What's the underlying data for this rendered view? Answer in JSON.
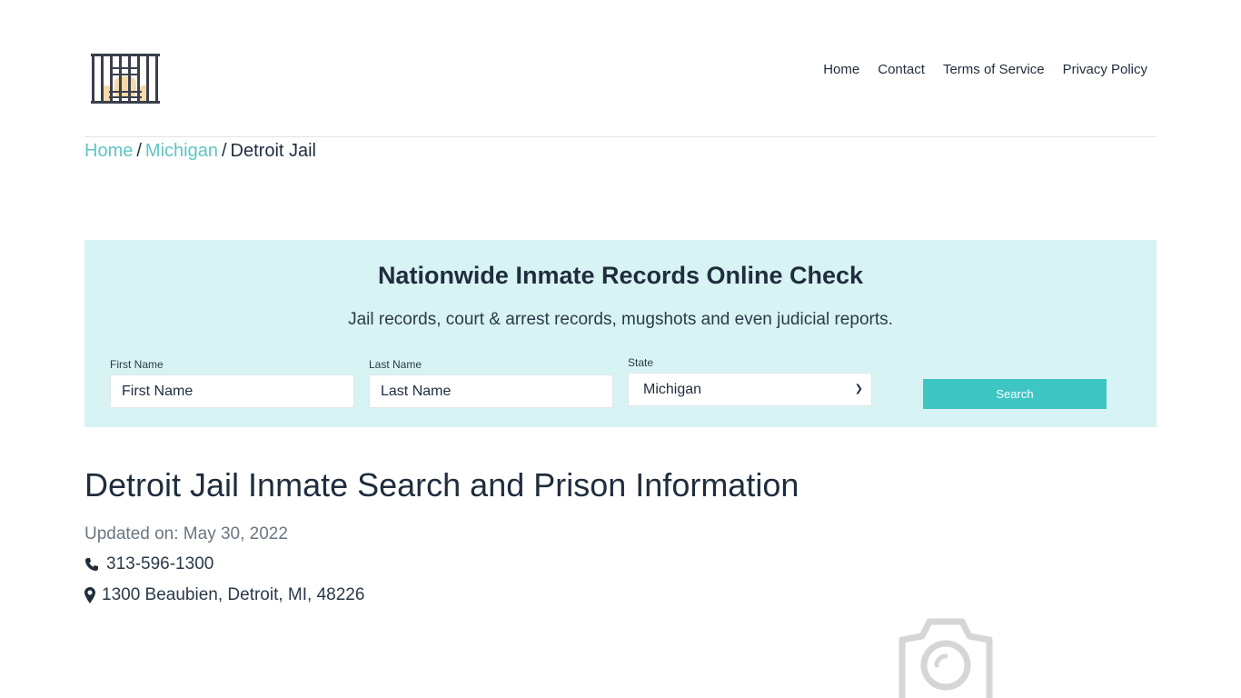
{
  "header": {
    "logo_icon": "jail-cell-icon",
    "nav": [
      {
        "label": "Home"
      },
      {
        "label": "Contact"
      },
      {
        "label": "Terms of Service"
      },
      {
        "label": "Privacy Policy"
      }
    ]
  },
  "breadcrumb": {
    "items": [
      {
        "label": "Home",
        "link": true
      },
      {
        "label": "Michigan",
        "link": true
      },
      {
        "label": "Detroit Jail",
        "link": false
      }
    ],
    "separator": "/"
  },
  "search_panel": {
    "title": "Nationwide Inmate Records Online Check",
    "subtitle": "Jail records, court & arrest records, mugshots and even judicial reports.",
    "first_name": {
      "label": "First Name",
      "placeholder": "First Name"
    },
    "last_name": {
      "label": "Last Name",
      "placeholder": "Last Name"
    },
    "state": {
      "label": "State",
      "selected": "Michigan"
    },
    "search_button": "Search",
    "background_color": "#d8f3f4",
    "button_color": "#3ec6c4"
  },
  "main": {
    "title": "Detroit Jail Inmate Search and Prison Information",
    "updated": "Updated on: May 30, 2022",
    "phone": "313-596-1300",
    "address": "1300 Beaubien, Detroit, MI, 48226",
    "image_placeholder_icon": "camera-icon"
  },
  "colors": {
    "accent": "#5fc6c4",
    "text": "#1f2d3d"
  }
}
